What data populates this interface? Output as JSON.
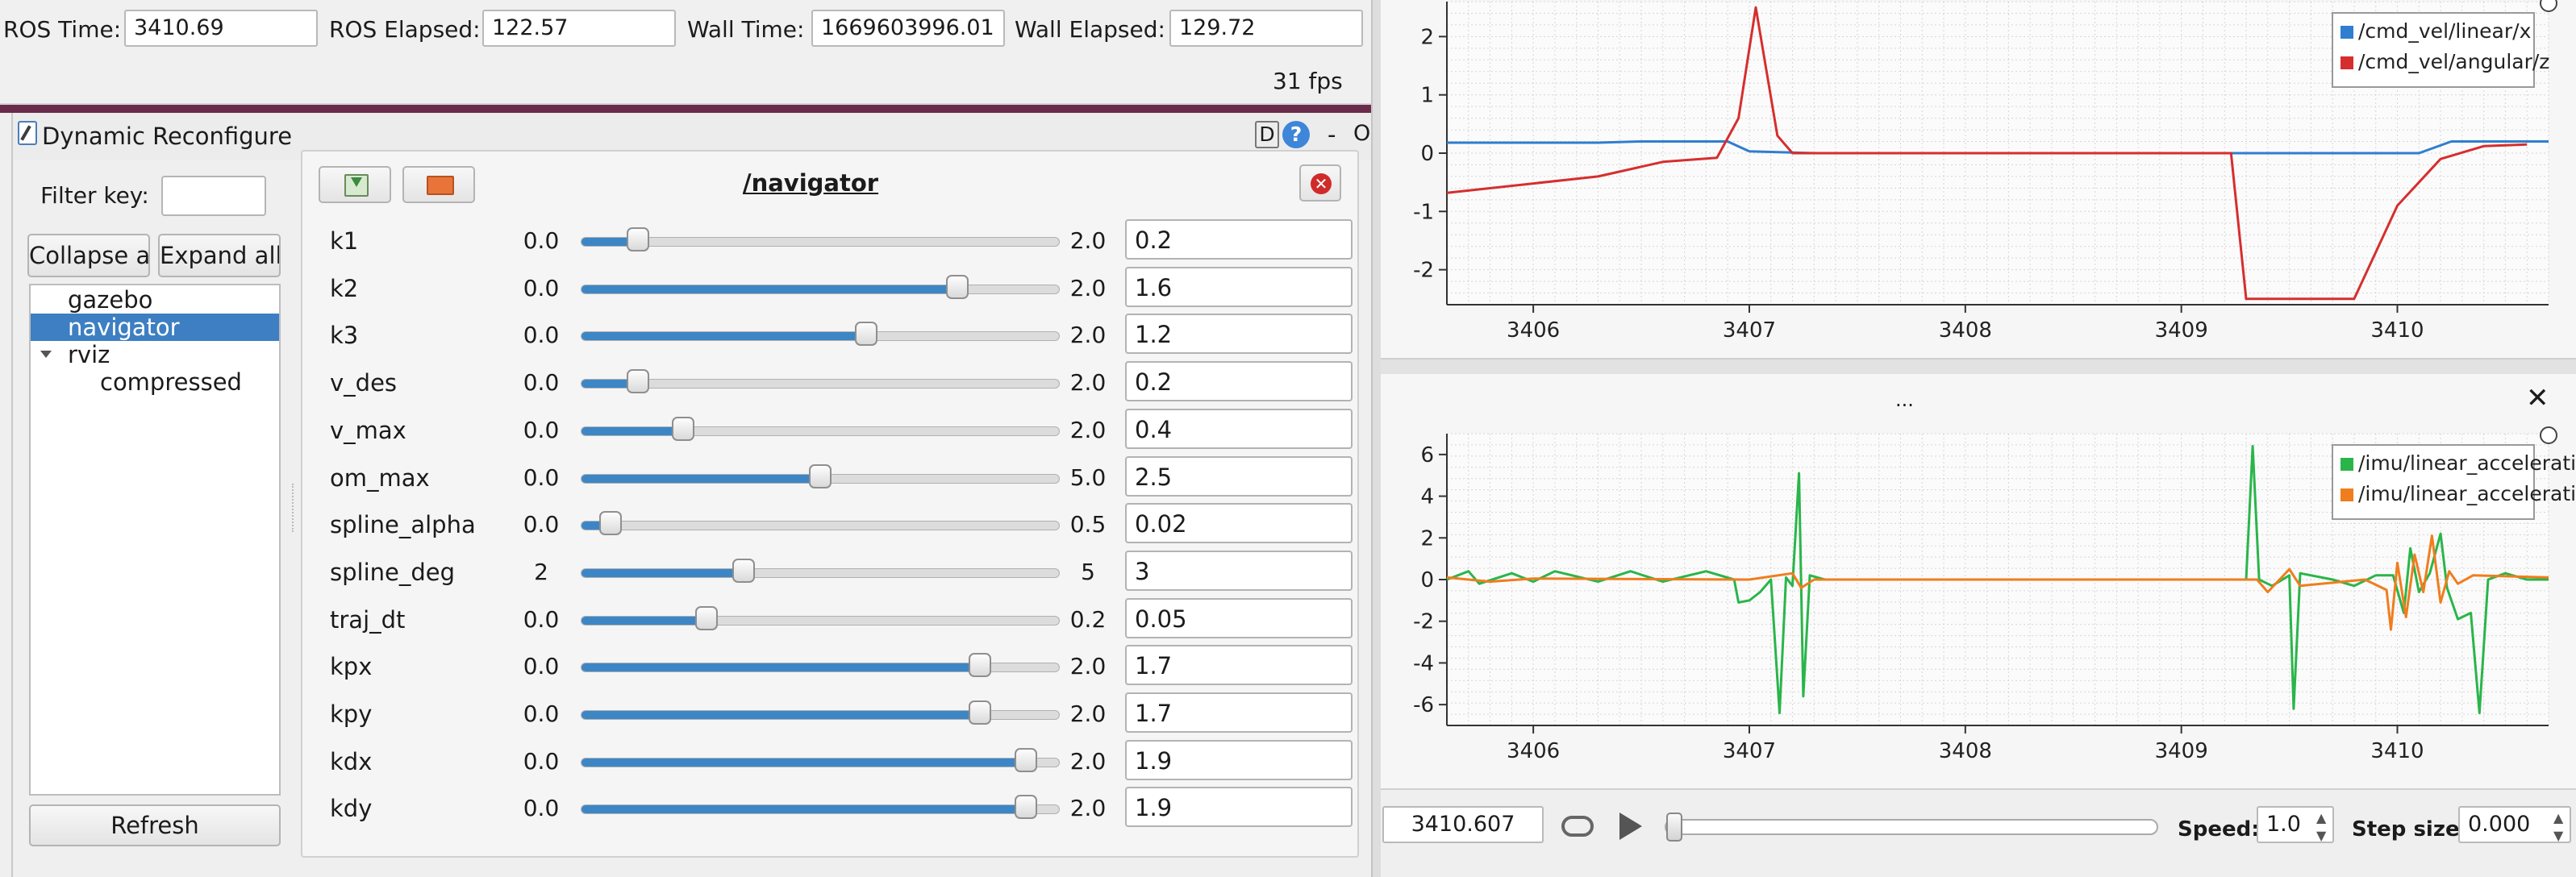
{
  "topbar": {
    "ros_time_label": "ROS Time:",
    "ros_time": "3410.69",
    "ros_elapsed_label": "ROS Elapsed:",
    "ros_elapsed": "122.57",
    "wall_time_label": "Wall Time:",
    "wall_time": "1669603996.01",
    "wall_elapsed_label": "Wall Elapsed:",
    "wall_elapsed": "129.72",
    "fps": "31 fps"
  },
  "dyn": {
    "title": "Dynamic Reconfigure",
    "title_buttons": [
      "D",
      "?",
      "-",
      "O"
    ],
    "filter_label": "Filter key:",
    "filter_value": "",
    "collapse_label": "Collapse all",
    "expand_label": "Expand all",
    "refresh_label": "Refresh",
    "tree": [
      {
        "label": "gazebo",
        "level": 0,
        "selected": false
      },
      {
        "label": "navigator",
        "level": 0,
        "selected": true
      },
      {
        "label": "rviz",
        "level": 0,
        "selected": false,
        "expanded": true
      },
      {
        "label": "compressed",
        "level": 1,
        "selected": false
      }
    ],
    "node_title": "/navigator",
    "params": [
      {
        "name": "k1",
        "min": "0.0",
        "max": "2.0",
        "value": "0.2",
        "fraction": 0.1
      },
      {
        "name": "k2",
        "min": "0.0",
        "max": "2.0",
        "value": "1.6",
        "fraction": 0.8
      },
      {
        "name": "k3",
        "min": "0.0",
        "max": "2.0",
        "value": "1.2",
        "fraction": 0.6
      },
      {
        "name": "v_des",
        "min": "0.0",
        "max": "2.0",
        "value": "0.2",
        "fraction": 0.1
      },
      {
        "name": "v_max",
        "min": "0.0",
        "max": "2.0",
        "value": "0.4",
        "fraction": 0.2
      },
      {
        "name": "om_max",
        "min": "0.0",
        "max": "5.0",
        "value": "2.5",
        "fraction": 0.5
      },
      {
        "name": "spline_alpha",
        "min": "0.0",
        "max": "0.5",
        "value": "0.02",
        "fraction": 0.04
      },
      {
        "name": "spline_deg",
        "min": "2",
        "max": "5",
        "value": "3",
        "fraction": 0.333
      },
      {
        "name": "traj_dt",
        "min": "0.0",
        "max": "0.2",
        "value": "0.05",
        "fraction": 0.25
      },
      {
        "name": "kpx",
        "min": "0.0",
        "max": "2.0",
        "value": "1.7",
        "fraction": 0.85
      },
      {
        "name": "kpy",
        "min": "0.0",
        "max": "2.0",
        "value": "1.7",
        "fraction": 0.85
      },
      {
        "name": "kdx",
        "min": "0.0",
        "max": "2.0",
        "value": "1.9",
        "fraction": 0.95
      },
      {
        "name": "kdy",
        "min": "0.0",
        "max": "2.0",
        "value": "1.9",
        "fraction": 0.95
      }
    ]
  },
  "plot_panel": {
    "bottom_title": "...",
    "close_glyph": "✕"
  },
  "playback": {
    "time": "3410.607",
    "speed_label": "Speed:",
    "speed": "1.0",
    "step_label": "Step size:",
    "step": "0.000"
  },
  "chart_data": [
    {
      "type": "line",
      "title": "",
      "xlabel": "",
      "ylabel": "",
      "xlim": [
        3405.6,
        3410.7
      ],
      "ylim": [
        -2.6,
        2.6
      ],
      "xticks": [
        3406,
        3407,
        3408,
        3409,
        3410
      ],
      "yticks": [
        2,
        1,
        0,
        -1,
        -2
      ],
      "grid": true,
      "legend_position": "top-right",
      "series": [
        {
          "name": "/cmd_vel/linear/x",
          "color": "#2f7ecf",
          "points": [
            [
              3405.6,
              0.18
            ],
            [
              3406.3,
              0.18
            ],
            [
              3406.5,
              0.2
            ],
            [
              3406.9,
              0.2
            ],
            [
              3407.0,
              0.03
            ],
            [
              3407.3,
              0.0
            ],
            [
              3410.1,
              0.0
            ],
            [
              3410.25,
              0.2
            ],
            [
              3410.7,
              0.2
            ]
          ]
        },
        {
          "name": "/cmd_vel/angular/z",
          "color": "#d62e2e",
          "points": [
            [
              3405.6,
              -0.68
            ],
            [
              3406.3,
              -0.4
            ],
            [
              3406.6,
              -0.15
            ],
            [
              3406.85,
              -0.08
            ],
            [
              3406.95,
              0.6
            ],
            [
              3407.03,
              2.5
            ],
            [
              3407.13,
              0.3
            ],
            [
              3407.2,
              0.0
            ],
            [
              3409.23,
              0.0
            ],
            [
              3409.3,
              -2.5
            ],
            [
              3409.8,
              -2.5
            ],
            [
              3410.0,
              -0.9
            ],
            [
              3410.2,
              -0.1
            ],
            [
              3410.4,
              0.12
            ],
            [
              3410.6,
              0.15
            ]
          ]
        }
      ]
    },
    {
      "type": "line",
      "title": "",
      "xlabel": "",
      "ylabel": "",
      "xlim": [
        3405.6,
        3410.7
      ],
      "ylim": [
        -7,
        7
      ],
      "xticks": [
        3406,
        3407,
        3408,
        3409,
        3410
      ],
      "yticks": [
        6,
        4,
        2,
        0,
        -2,
        -4,
        -6
      ],
      "grid": true,
      "legend_position": "top-right",
      "series": [
        {
          "name": "/imu/linear_acceleration/x",
          "color": "#2ab54a",
          "points": [
            [
              3405.6,
              0.0
            ],
            [
              3405.7,
              0.4
            ],
            [
              3405.75,
              -0.2
            ],
            [
              3405.9,
              0.3
            ],
            [
              3406.0,
              -0.1
            ],
            [
              3406.1,
              0.4
            ],
            [
              3406.3,
              -0.1
            ],
            [
              3406.45,
              0.4
            ],
            [
              3406.6,
              -0.1
            ],
            [
              3406.8,
              0.4
            ],
            [
              3406.93,
              0.0
            ],
            [
              3406.95,
              -1.1
            ],
            [
              3407.0,
              -1.0
            ],
            [
              3407.05,
              -0.6
            ],
            [
              3407.1,
              0.0
            ],
            [
              3407.14,
              -6.4
            ],
            [
              3407.17,
              0.1
            ],
            [
              3407.2,
              -0.3
            ],
            [
              3407.23,
              5.1
            ],
            [
              3407.25,
              -5.6
            ],
            [
              3407.28,
              0.2
            ],
            [
              3407.35,
              0.0
            ],
            [
              3409.3,
              0.0
            ],
            [
              3409.33,
              6.4
            ],
            [
              3409.36,
              0.0
            ],
            [
              3409.42,
              -0.3
            ],
            [
              3409.5,
              0.2
            ],
            [
              3409.52,
              -6.2
            ],
            [
              3409.55,
              0.3
            ],
            [
              3409.7,
              0.0
            ],
            [
              3409.8,
              -0.3
            ],
            [
              3409.9,
              0.2
            ],
            [
              3409.98,
              0.2
            ],
            [
              3410.03,
              -1.6
            ],
            [
              3410.06,
              1.5
            ],
            [
              3410.1,
              -0.6
            ],
            [
              3410.15,
              0.3
            ],
            [
              3410.2,
              2.2
            ],
            [
              3410.23,
              -0.4
            ],
            [
              3410.28,
              -1.9
            ],
            [
              3410.34,
              -1.6
            ],
            [
              3410.38,
              -6.4
            ],
            [
              3410.42,
              0.0
            ],
            [
              3410.5,
              0.3
            ],
            [
              3410.6,
              0.0
            ],
            [
              3410.7,
              0.0
            ]
          ]
        },
        {
          "name": "/imu/linear_acceleration/y",
          "color": "#f07d1e",
          "points": [
            [
              3405.6,
              0.1
            ],
            [
              3405.8,
              -0.1
            ],
            [
              3406.0,
              0.05
            ],
            [
              3407.0,
              0.0
            ],
            [
              3407.2,
              0.3
            ],
            [
              3407.24,
              -0.4
            ],
            [
              3407.3,
              0.0
            ],
            [
              3409.35,
              0.0
            ],
            [
              3409.4,
              -0.6
            ],
            [
              3409.5,
              0.5
            ],
            [
              3409.55,
              -0.3
            ],
            [
              3409.85,
              0.0
            ],
            [
              3409.95,
              -0.5
            ],
            [
              3409.97,
              -2.4
            ],
            [
              3410.0,
              0.8
            ],
            [
              3410.04,
              -1.8
            ],
            [
              3410.08,
              1.2
            ],
            [
              3410.12,
              -0.6
            ],
            [
              3410.16,
              2.1
            ],
            [
              3410.2,
              -1.1
            ],
            [
              3410.24,
              0.4
            ],
            [
              3410.28,
              -0.2
            ],
            [
              3410.35,
              0.2
            ],
            [
              3410.7,
              0.1
            ]
          ]
        }
      ]
    }
  ]
}
